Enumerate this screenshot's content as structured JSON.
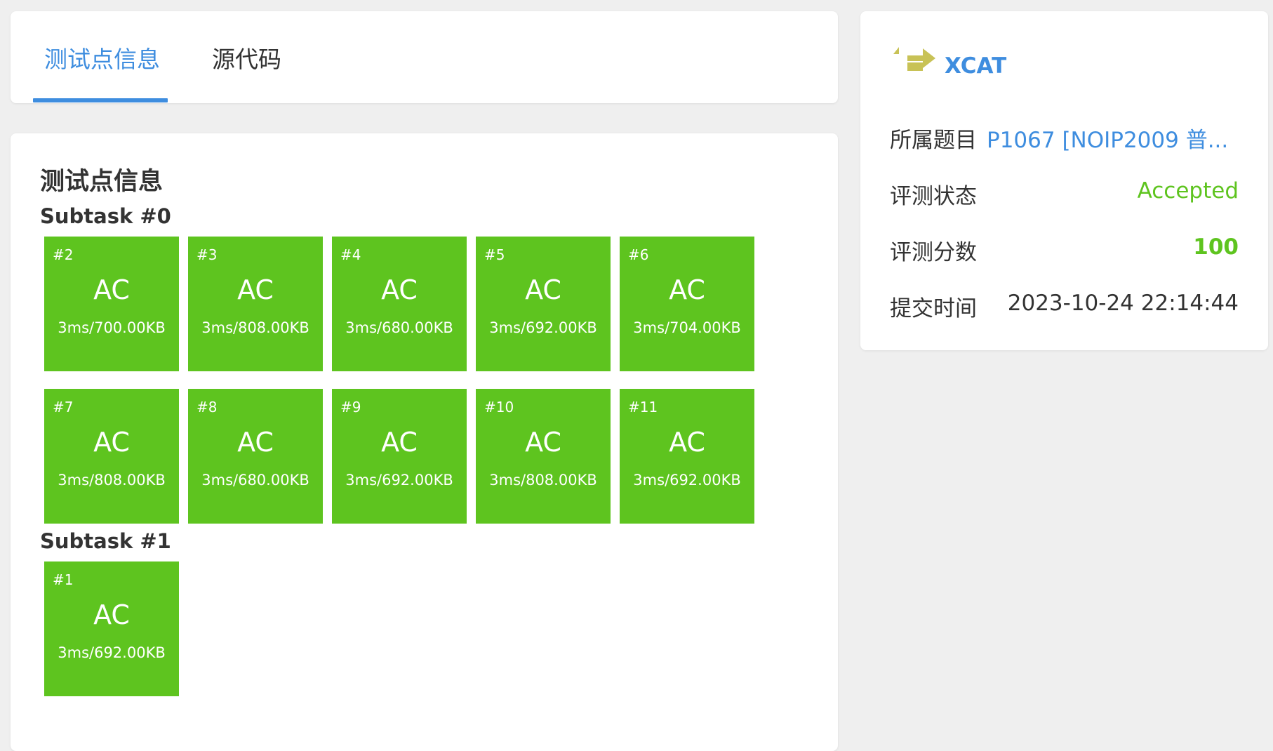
{
  "tabs": [
    {
      "label": "测试点信息",
      "active": true
    },
    {
      "label": "源代码",
      "active": false
    }
  ],
  "cases": {
    "title": "测试点信息",
    "subtasks": [
      {
        "label": "Subtask #0",
        "tests": [
          {
            "id": "#2",
            "status": "AC",
            "result": "3ms/700.00KB"
          },
          {
            "id": "#3",
            "status": "AC",
            "result": "3ms/808.00KB"
          },
          {
            "id": "#4",
            "status": "AC",
            "result": "3ms/680.00KB"
          },
          {
            "id": "#5",
            "status": "AC",
            "result": "3ms/692.00KB"
          },
          {
            "id": "#6",
            "status": "AC",
            "result": "3ms/704.00KB"
          },
          {
            "id": "#7",
            "status": "AC",
            "result": "3ms/808.00KB"
          },
          {
            "id": "#8",
            "status": "AC",
            "result": "3ms/680.00KB"
          },
          {
            "id": "#9",
            "status": "AC",
            "result": "3ms/692.00KB"
          },
          {
            "id": "#10",
            "status": "AC",
            "result": "3ms/808.00KB"
          },
          {
            "id": "#11",
            "status": "AC",
            "result": "3ms/692.00KB"
          }
        ]
      },
      {
        "label": "Subtask #1",
        "tests": [
          {
            "id": "#1",
            "status": "AC",
            "result": "3ms/692.00KB"
          }
        ]
      }
    ]
  },
  "info": {
    "user": "XCAT",
    "problem_label": "所属题目",
    "problem_value": "P1067 [NOIP2009 普...",
    "status_label": "评测状态",
    "status_value": "Accepted",
    "score_label": "评测分数",
    "score_value": "100",
    "time_label": "提交时间",
    "time_value": "2023-10-24 22:14:44"
  },
  "colors": {
    "accent": "#3e8ddf",
    "ac_tile": "#5ec41f",
    "accepted_text": "#5ec41f",
    "background": "#efefef"
  }
}
